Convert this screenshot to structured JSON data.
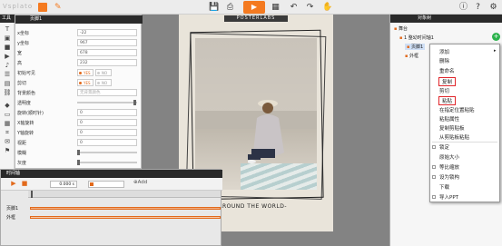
{
  "app": {
    "logo": "Vsplato"
  },
  "toolbar": {
    "icons": [
      "save-icon",
      "print-icon",
      "play-icon",
      "qrcode-icon",
      "undo-icon",
      "redo-icon",
      "hand-icon",
      "info-icon",
      "help-icon",
      "settings-icon"
    ],
    "play_glyph": "▶"
  },
  "tools_panel": {
    "title": "工具"
  },
  "properties": {
    "title": "页脚1",
    "fields": [
      {
        "label": "x坐标",
        "value": "-22"
      },
      {
        "label": "y坐标",
        "value": "967"
      },
      {
        "label": "宽",
        "value": "678"
      },
      {
        "label": "高",
        "value": "232"
      }
    ],
    "initial_visible": {
      "label": "初始可见",
      "yes": "YES",
      "no": "NO"
    },
    "clip": {
      "label": "剪切",
      "yes": "YES",
      "no": "NO"
    },
    "bg_color": {
      "label": "背景颜色",
      "placeholder": "无背景颜色"
    },
    "opacity": {
      "label": "透明度"
    },
    "rotate": {
      "label": "旋转(顺时针)",
      "value": "0"
    },
    "x_rotate": {
      "label": "X轴旋转",
      "value": "0"
    },
    "y_rotate": {
      "label": "Y轴旋转",
      "value": "0"
    },
    "perspective": {
      "label": "视距",
      "value": "0"
    },
    "blur": {
      "label": "模糊"
    },
    "gray": {
      "label": "灰度"
    },
    "brightness": {
      "label": "亮度"
    }
  },
  "poster": {
    "title": "POSTERLABS",
    "bottom_text": "AVEL AROUND THE WORLD-"
  },
  "timeline": {
    "title": "时间轴",
    "time_value": "0.000 s",
    "add_label": "Add",
    "tracks": [
      {
        "label": "页脚1"
      },
      {
        "label": "外框"
      }
    ]
  },
  "objects": {
    "title": "对象树",
    "tree": [
      {
        "label": "舞台"
      },
      {
        "label": "1 整幼时间轴1"
      },
      {
        "label": "页脚1"
      },
      {
        "label": "外框"
      }
    ]
  },
  "context_menu": {
    "items": [
      {
        "label": "添加",
        "type": "submenu"
      },
      {
        "label": "删除"
      },
      {
        "label": "重命名"
      },
      {
        "label": "复制",
        "highlight": true
      },
      {
        "label": "剪切"
      },
      {
        "label": "粘贴",
        "highlight": true
      },
      {
        "label": "在指定位置粘贴"
      },
      {
        "label": "粘贴属性"
      },
      {
        "label": "复制剪贴板"
      },
      {
        "label": "从剪贴板粘贴"
      },
      {
        "label": "锁定",
        "check": true
      },
      {
        "label": "原始大小"
      },
      {
        "label": "等比缩放",
        "check": true
      },
      {
        "label": "设为锁构",
        "check": true
      },
      {
        "label": "下载"
      },
      {
        "label": "导入PPT",
        "check": true
      }
    ]
  },
  "colors": {
    "accent": "#f47a20",
    "highlight": "#e0262b",
    "header": "#2a2a2a"
  }
}
